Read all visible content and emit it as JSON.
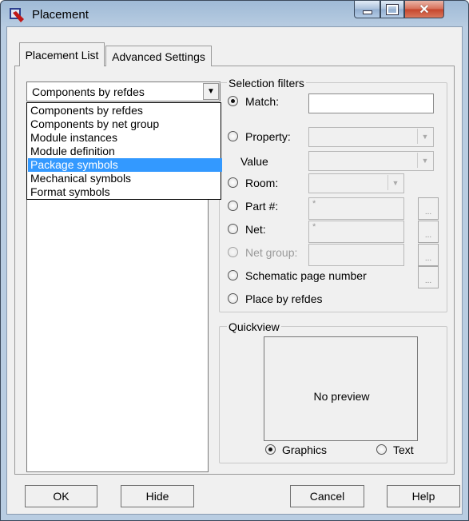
{
  "window": {
    "title": "Placement"
  },
  "tabs": [
    {
      "label": "Placement List",
      "active": true
    },
    {
      "label": "Advanced Settings",
      "active": false
    }
  ],
  "combo": {
    "value": "Components by refdes",
    "options": [
      "Components by refdes",
      "Components by net group",
      "Module instances",
      "Module definition",
      "Package symbols",
      "Mechanical symbols",
      "Format symbols"
    ],
    "highlighted_option": "Package symbols"
  },
  "selection_filters": {
    "legend": "Selection filters",
    "match_label": "Match:",
    "property_label": "Property:",
    "value_label": "Value",
    "room_label": "Room:",
    "part_label": "Part #:",
    "part_value": "*",
    "net_label": "Net:",
    "net_value": "*",
    "net_group_label": "Net group:",
    "schematic_label": "Schematic page number",
    "place_by_refdes_label": "Place by refdes",
    "ellipsis": "..."
  },
  "quickview": {
    "legend": "Quickview",
    "preview_text": "No preview",
    "graphics_label": "Graphics",
    "text_label": "Text"
  },
  "buttons": {
    "ok": "OK",
    "hide": "Hide",
    "cancel": "Cancel",
    "help": "Help"
  }
}
